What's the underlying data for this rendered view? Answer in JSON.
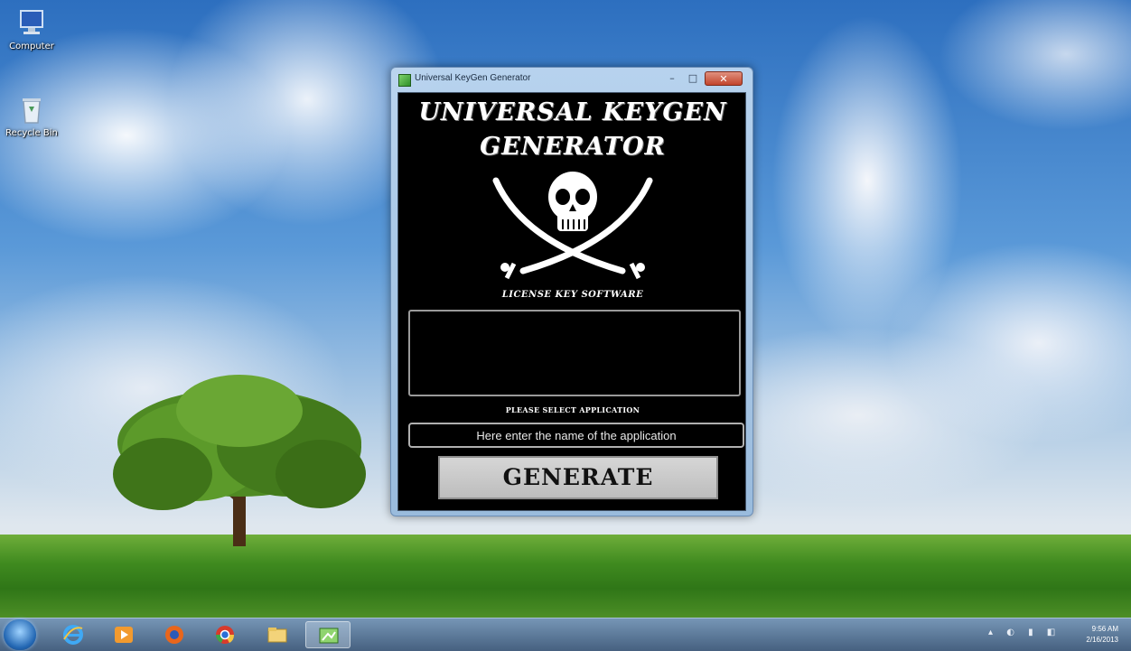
{
  "desktop": {
    "icons": [
      {
        "label": "Computer",
        "icon": "computer-icon"
      },
      {
        "label": "Recycle Bin",
        "icon": "recycle-bin-icon"
      }
    ]
  },
  "window": {
    "title": "Universal KeyGen Generator",
    "controls": {
      "minimize": "–",
      "maximize": "□",
      "close": "✕"
    },
    "heading_line1": "UNIVERSAL KEYGEN",
    "heading_line2": "GENERATOR",
    "logo": "skull-crossed-swords-icon",
    "tagline": "LICENSE KEY SOFTWARE",
    "output_value": "",
    "select_label": "PLEASE SELECT APPLICATION",
    "app_input_placeholder": "Here enter the name of the application",
    "generate_label": "GENERATE"
  },
  "taskbar": {
    "pinned": [
      "start-orb-icon",
      "internet-explorer-icon",
      "media-player-icon",
      "firefox-icon",
      "chrome-icon",
      "file-explorer-icon",
      "keygen-app-icon"
    ],
    "clock_time": "9:56 AM",
    "clock_date": "2/16/2013"
  }
}
